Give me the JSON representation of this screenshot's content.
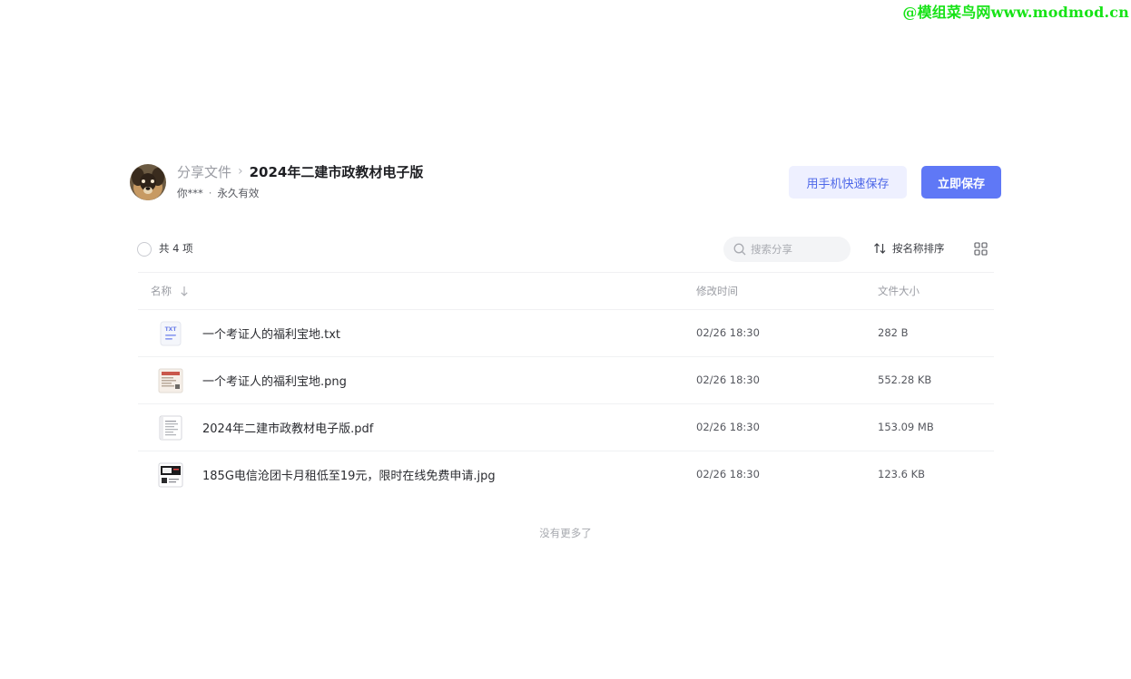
{
  "watermark": "@模组菜鸟网www.modmod.cn",
  "header": {
    "breadcrumb_root": "分享文件",
    "breadcrumb_separator": "›",
    "title": "2024年二建市政教材电子版",
    "sharer": "你***",
    "meta_separator": "·",
    "validity": "永久有效",
    "phone_save_label": "用手机快速保存",
    "save_label": "立即保存"
  },
  "toolbar": {
    "total": "共 4 项",
    "search_placeholder": "搜索分享",
    "sort_label": "按名称排序"
  },
  "table": {
    "columns": {
      "name": "名称",
      "modified": "修改时间",
      "size": "文件大小"
    },
    "rows": [
      {
        "name": "一个考证人的福利宝地.txt",
        "modified": "02/26 18:30",
        "size": "282 B",
        "icon": "txt-file-icon"
      },
      {
        "name": "一个考证人的福利宝地.png",
        "modified": "02/26 18:30",
        "size": "552.28 KB",
        "icon": "image-thumbnail-icon"
      },
      {
        "name": "2024年二建市政教材电子版.pdf",
        "modified": "02/26 18:30",
        "size": "153.09 MB",
        "icon": "pdf-thumbnail-icon"
      },
      {
        "name": "185G电信沧团卡月租低至19元，限时在线免费申请.jpg",
        "modified": "02/26 18:30",
        "size": "123.6 KB",
        "icon": "jpg-thumbnail-icon"
      }
    ]
  },
  "footer": {
    "no_more": "没有更多了"
  },
  "colors": {
    "accent": "#5f78f6",
    "accent_light": "#eef0ff",
    "watermark": "#17e317"
  }
}
